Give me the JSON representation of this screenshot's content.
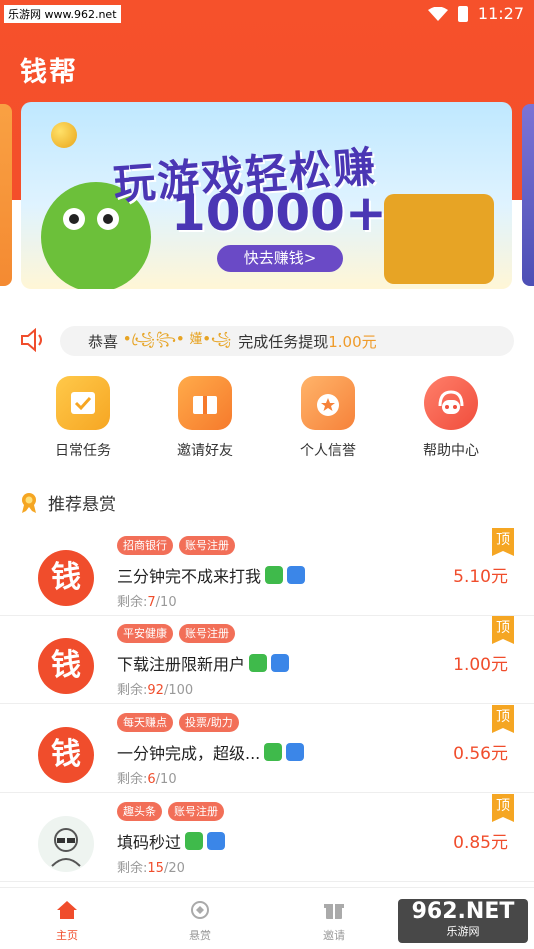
{
  "status_bar": {
    "watermark": "乐游网 www.962.net",
    "time": "11:27"
  },
  "app_title": "钱帮",
  "banner": {
    "title": "玩游戏轻松赚",
    "amount": "10000+",
    "button": "快去赚钱>"
  },
  "notice": {
    "prefix": "恭喜",
    "user_masked": "ꔷ꧁ꦿ꧂ꔷ 嬞ꔷ꧁",
    "message": "完成任务提现",
    "amount": "1.00元"
  },
  "quick_menu": [
    {
      "label": "日常任务",
      "icon": "calendar-check-icon"
    },
    {
      "label": "邀请好友",
      "icon": "gift-icon"
    },
    {
      "label": "个人信誉",
      "icon": "medal-star-icon"
    },
    {
      "label": "帮助中心",
      "icon": "headset-icon"
    }
  ],
  "section": {
    "title": "推荐悬赏",
    "icon": "medal-icon"
  },
  "tasks": [
    {
      "avatar_text": "钱",
      "tags": [
        "招商银行",
        "账号注册"
      ],
      "title": "三分钟完不成来打我",
      "remain_label": "剩余:",
      "remain": "7",
      "total": "/10",
      "price": "5.10元",
      "badge": "顶"
    },
    {
      "avatar_text": "钱",
      "tags": [
        "平安健康",
        "账号注册"
      ],
      "title": "下载注册限新用户",
      "remain_label": "剩余:",
      "remain": "92",
      "total": "/100",
      "price": "1.00元",
      "badge": "顶"
    },
    {
      "avatar_text": "钱",
      "tags": [
        "每天赚点",
        "投票/助力"
      ],
      "title": "一分钟完成，超级...",
      "remain_label": "剩余:",
      "remain": "6",
      "total": "/10",
      "price": "0.56元",
      "badge": "顶"
    },
    {
      "avatar_text": "",
      "tags": [
        "趣头条",
        "账号注册"
      ],
      "title": "填码秒过",
      "remain_label": "剩余:",
      "remain": "15",
      "total": "/20",
      "price": "0.85元",
      "badge": "顶"
    }
  ],
  "bottom_nav": [
    {
      "label": "主页",
      "icon": "home-icon",
      "active": true
    },
    {
      "label": "悬赏",
      "icon": "reward-icon",
      "active": false
    },
    {
      "label": "邀请",
      "icon": "invite-icon",
      "active": false
    }
  ],
  "watermark_962": {
    "big": "962.NET",
    "small": "乐游网"
  },
  "colors": {
    "primary": "#f04d2c",
    "accent": "#f5a623",
    "tag": "#f26f58"
  }
}
